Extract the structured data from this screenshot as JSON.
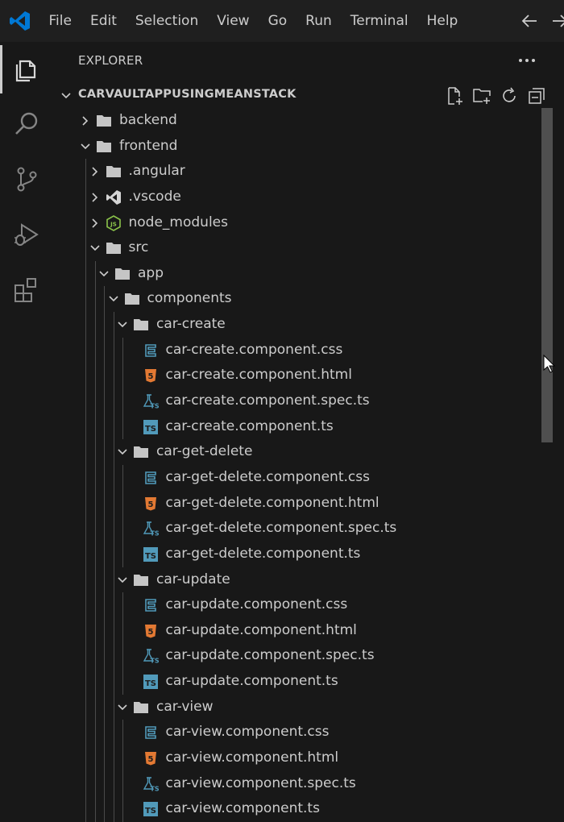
{
  "menu": [
    "File",
    "Edit",
    "Selection",
    "View",
    "Go",
    "Run",
    "Terminal",
    "Help"
  ],
  "explorer": {
    "title": "EXPLORER",
    "section_title": "CARVAULTAPPUSINGMEANSTACK",
    "tree": [
      {
        "label": "backend",
        "kind": "folder",
        "open": false,
        "depth": 0
      },
      {
        "label": "frontend",
        "kind": "folder",
        "open": true,
        "depth": 0
      },
      {
        "label": ".angular",
        "kind": "folder",
        "open": false,
        "depth": 1
      },
      {
        "label": ".vscode",
        "kind": "vscode-folder",
        "open": false,
        "depth": 1
      },
      {
        "label": "node_modules",
        "kind": "node-folder",
        "open": false,
        "depth": 1
      },
      {
        "label": "src",
        "kind": "folder",
        "open": true,
        "depth": 1
      },
      {
        "label": "app",
        "kind": "folder",
        "open": true,
        "depth": 2
      },
      {
        "label": "components",
        "kind": "folder",
        "open": true,
        "depth": 3
      },
      {
        "label": "car-create",
        "kind": "folder",
        "open": true,
        "depth": 4
      },
      {
        "label": "car-create.component.css",
        "kind": "css",
        "depth": 5
      },
      {
        "label": "car-create.component.html",
        "kind": "html",
        "depth": 5
      },
      {
        "label": "car-create.component.spec.ts",
        "kind": "spec",
        "depth": 5
      },
      {
        "label": "car-create.component.ts",
        "kind": "ts",
        "depth": 5
      },
      {
        "label": "car-get-delete",
        "kind": "folder",
        "open": true,
        "depth": 4
      },
      {
        "label": "car-get-delete.component.css",
        "kind": "css",
        "depth": 5
      },
      {
        "label": "car-get-delete.component.html",
        "kind": "html",
        "depth": 5
      },
      {
        "label": "car-get-delete.component.spec.ts",
        "kind": "spec",
        "depth": 5
      },
      {
        "label": "car-get-delete.component.ts",
        "kind": "ts",
        "depth": 5
      },
      {
        "label": "car-update",
        "kind": "folder",
        "open": true,
        "depth": 4
      },
      {
        "label": "car-update.component.css",
        "kind": "css",
        "depth": 5
      },
      {
        "label": "car-update.component.html",
        "kind": "html",
        "depth": 5
      },
      {
        "label": "car-update.component.spec.ts",
        "kind": "spec",
        "depth": 5
      },
      {
        "label": "car-update.component.ts",
        "kind": "ts",
        "depth": 5
      },
      {
        "label": "car-view",
        "kind": "folder",
        "open": true,
        "depth": 4
      },
      {
        "label": "car-view.component.css",
        "kind": "css",
        "depth": 5
      },
      {
        "label": "car-view.component.html",
        "kind": "html",
        "depth": 5
      },
      {
        "label": "car-view.component.spec.ts",
        "kind": "spec",
        "depth": 5
      },
      {
        "label": "car-view.component.ts",
        "kind": "ts",
        "depth": 5
      }
    ]
  },
  "icon_names": {
    "activity_bar": [
      "explorer-icon",
      "search-icon",
      "source-control-icon",
      "run-debug-icon",
      "extensions-icon"
    ],
    "section_actions": [
      "new-file-icon",
      "new-folder-icon",
      "refresh-icon",
      "collapse-all-icon"
    ]
  },
  "colors": {
    "accent": "#0078d4",
    "css_icon": "#519aba",
    "html_icon": "#e37933",
    "ts_icon": "#519aba",
    "node_icon": "#8bc34a"
  }
}
